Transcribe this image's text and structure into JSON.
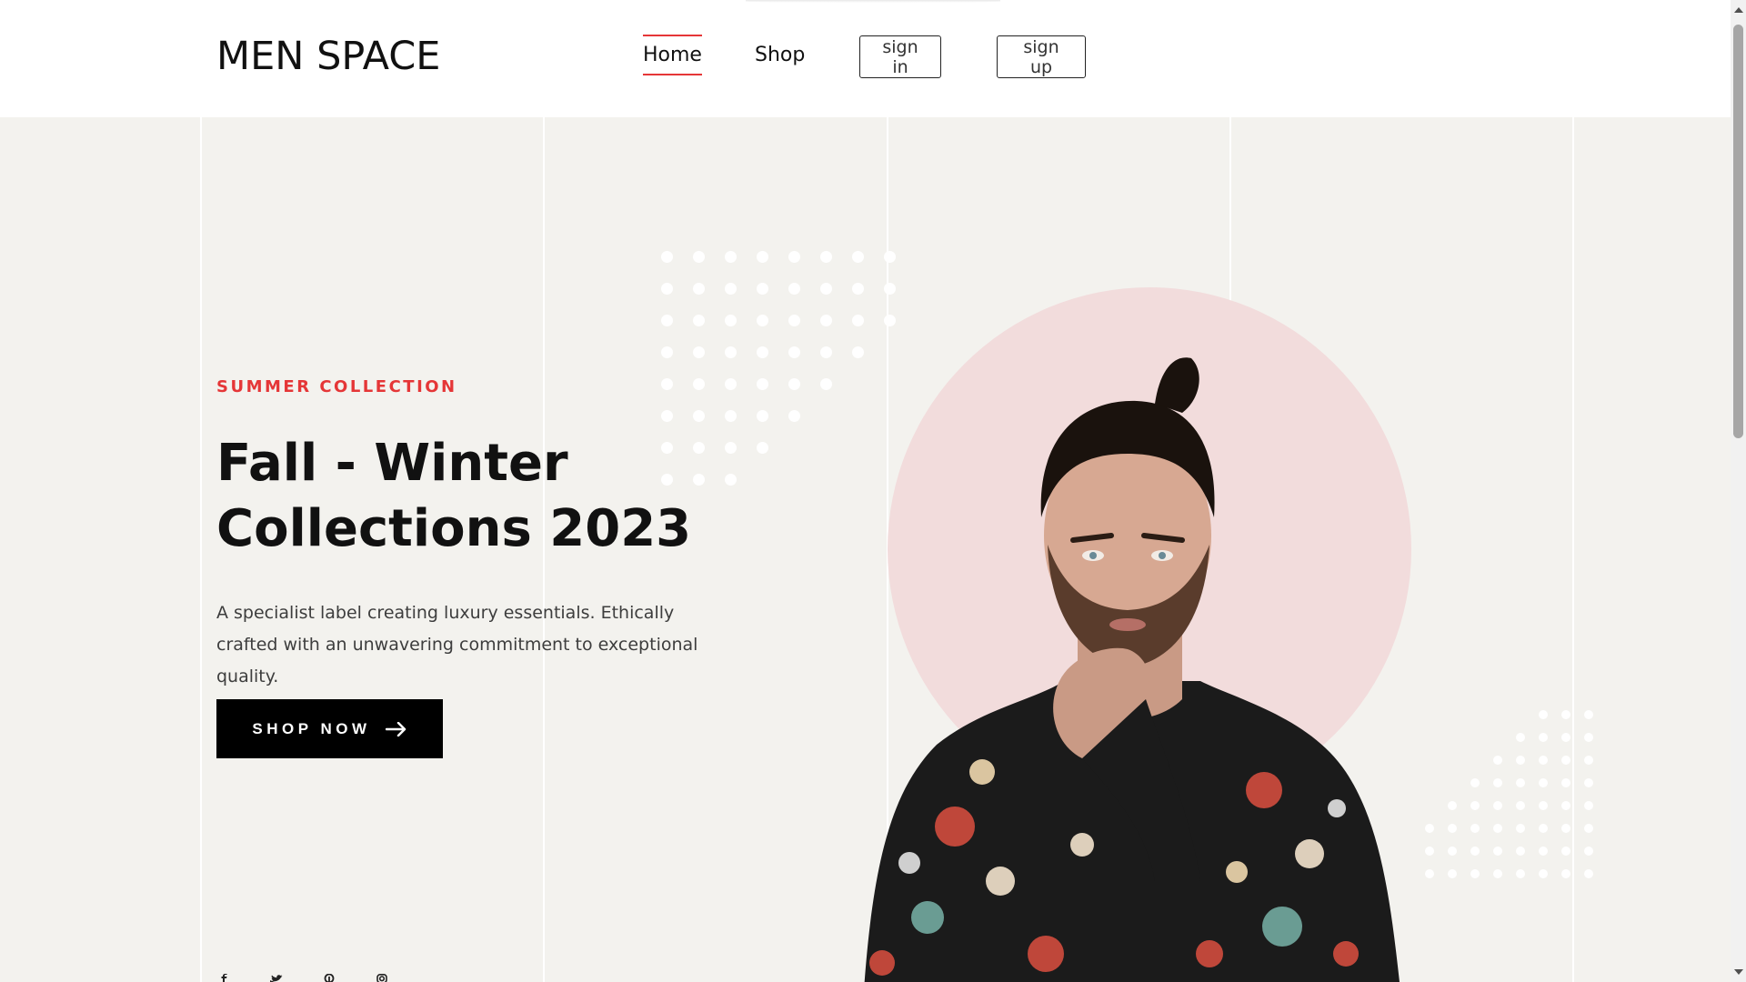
{
  "brand": {
    "logo": "MEN SPACE"
  },
  "nav": {
    "home": "Home",
    "shop": "Shop",
    "sign_in": "sign in",
    "sign_up": "sign up",
    "active": "Home"
  },
  "hero": {
    "subtitle": "SUMMER COLLECTION",
    "title": "Fall - Winter Collections 2023",
    "description": "A specialist label creating luxury essentials. Ethically crafted with an unwavering commitment to exceptional quality.",
    "cta_label": "SHOP NOW",
    "cta_icon": "arrow-right-icon"
  },
  "social": [
    "facebook-icon",
    "twitter-icon",
    "pinterest-icon",
    "instagram-icon"
  ],
  "colors": {
    "accent": "#e53637",
    "hero_bg": "#f3f2ee",
    "circle": "#f2dcdc",
    "button_bg": "#000000",
    "text": "#111111"
  }
}
